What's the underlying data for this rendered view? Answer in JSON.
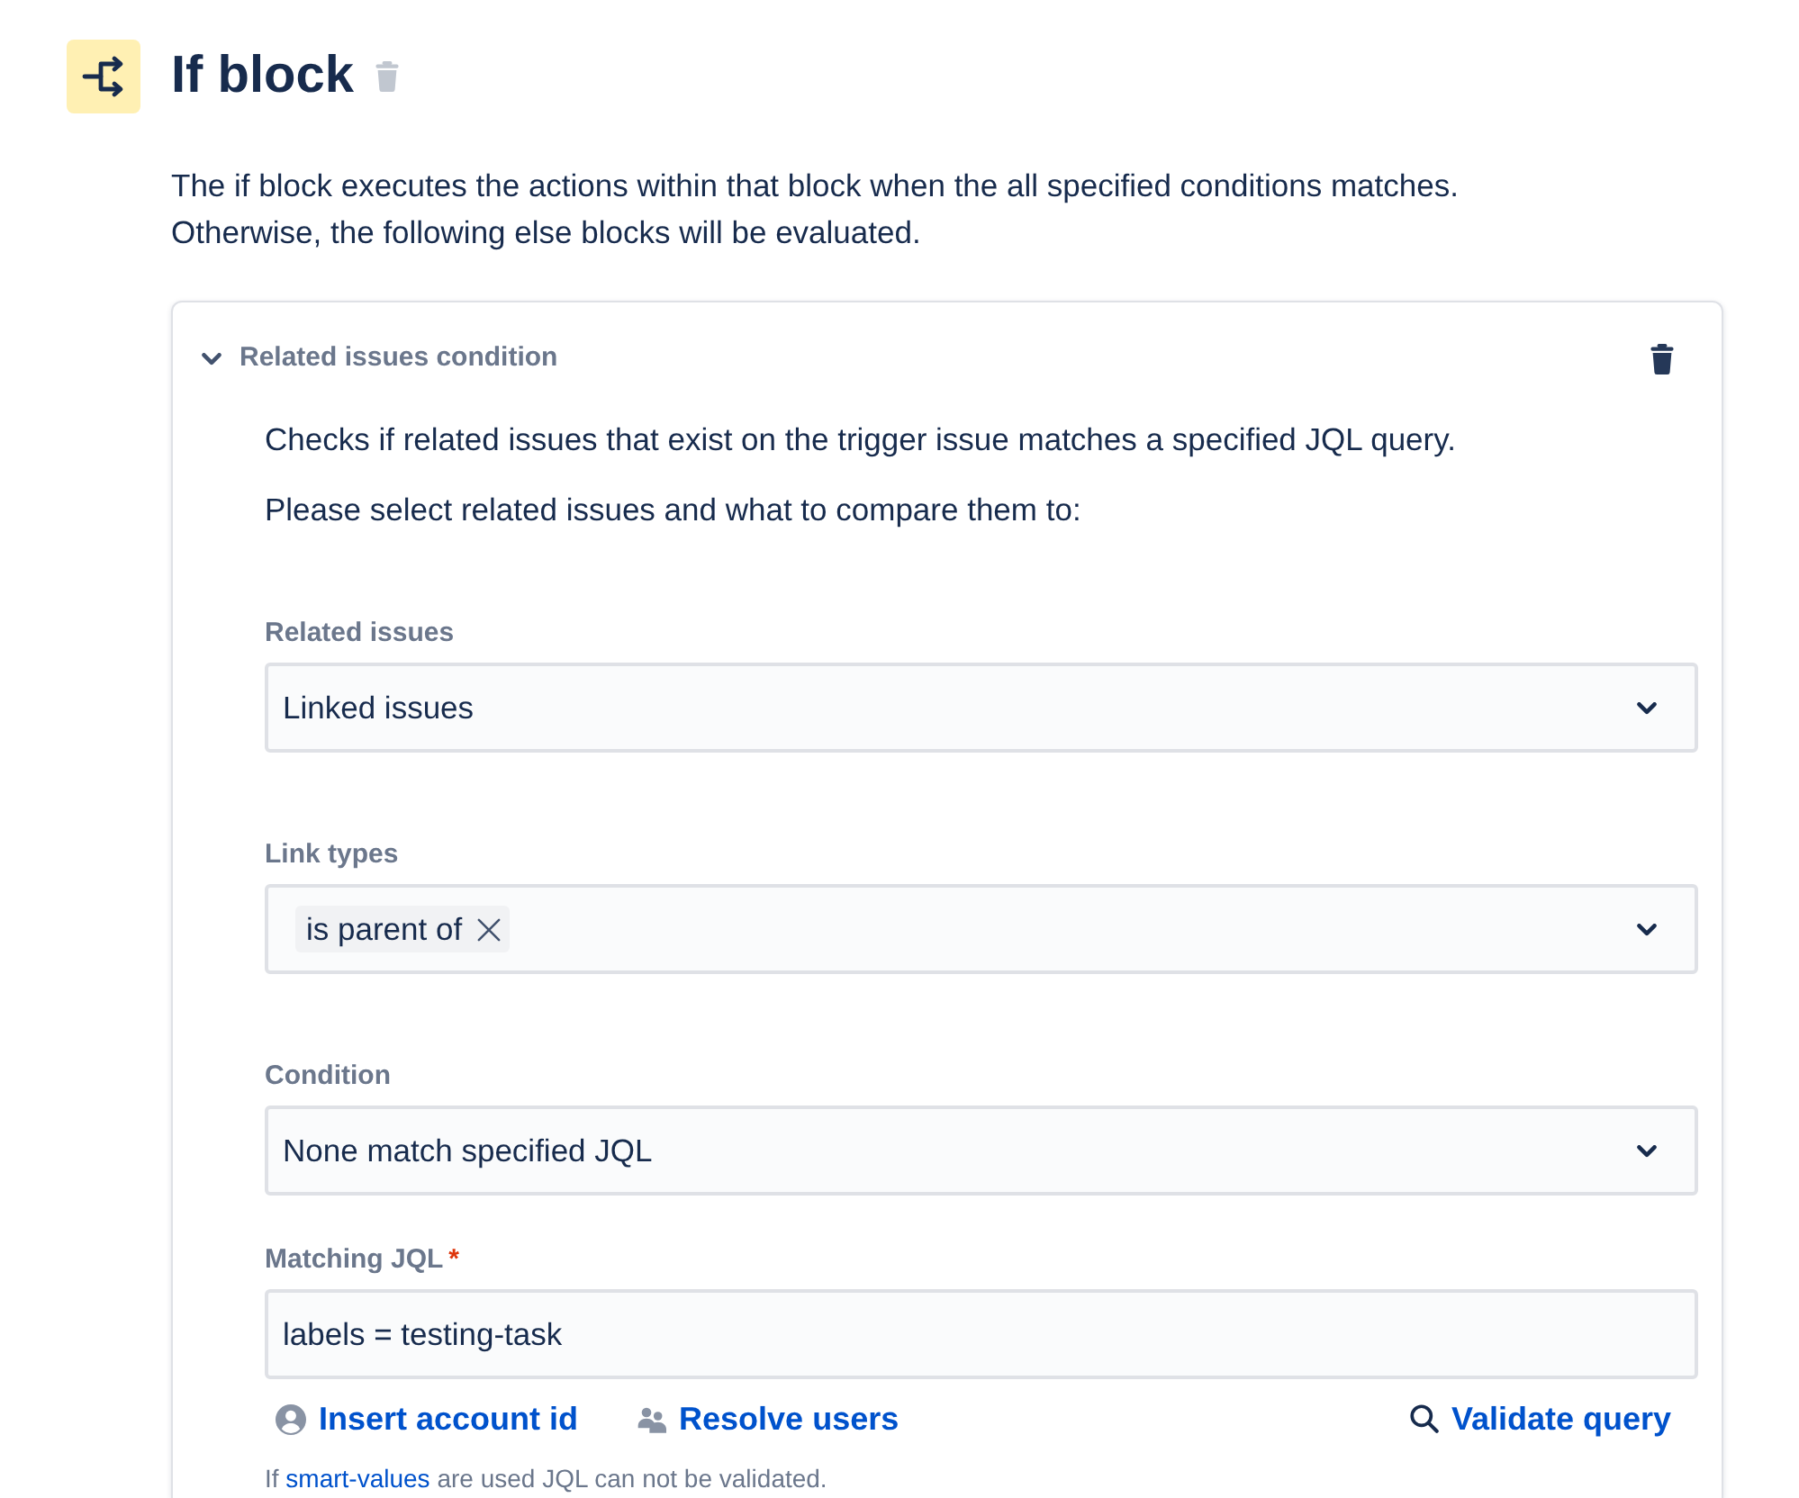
{
  "header": {
    "title": "If block",
    "delete_disabled": true
  },
  "description": "The if block executes the actions within that block when the all specified conditions matches. Otherwise, the following else blocks will be evaluated.",
  "condition": {
    "title": "Related issues condition",
    "expanded": true,
    "delete_disabled": false,
    "description": "Checks if related issues that exist on the trigger issue matches a specified JQL query.",
    "prompt": "Please select related issues and what to compare them to:",
    "fields": [
      {
        "kind": "select",
        "label": "Related issues",
        "value": "Linked issues"
      },
      {
        "kind": "multiselect",
        "label": "Link types",
        "tags": [
          "is parent of"
        ]
      },
      {
        "kind": "select",
        "label": "Condition",
        "value": "None match specified JQL"
      },
      {
        "kind": "text",
        "label": "Matching JQL",
        "required_mark": "*",
        "value": "labels = testing-task"
      }
    ],
    "actions": [
      {
        "kind": "account",
        "label": "Insert account id"
      },
      {
        "kind": "users",
        "label": "Resolve users"
      },
      {
        "kind": "validate",
        "label": "Validate query"
      }
    ],
    "help": {
      "before": "If",
      "link": "smart-values",
      "after": "are used JQL can not be validated."
    }
  }
}
